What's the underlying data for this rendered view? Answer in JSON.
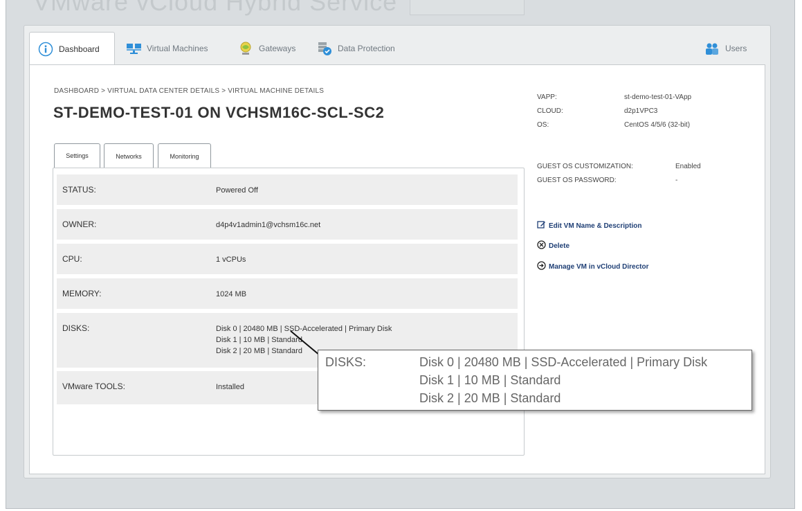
{
  "brand": {
    "title": "VMware vCloud Hybrid Service"
  },
  "main_tabs": [
    {
      "label": "Dashboard",
      "icon": "info-circle-icon"
    },
    {
      "label": "Virtual Machines",
      "icon": "monitors-icon"
    },
    {
      "label": "Gateways",
      "icon": "gateway-globe-icon"
    },
    {
      "label": "Data Protection",
      "icon": "data-protection-icon"
    }
  ],
  "users_tab": {
    "label": "Users",
    "icon": "users-icon"
  },
  "breadcrumb": "DASHBOARD > VIRTUAL DATA CENTER DETAILS > VIRTUAL MACHINE DETAILS",
  "page_title": "ST-DEMO-TEST-01 ON VCHSM16C-SCL-SC2",
  "inner_tabs": [
    "Settings",
    "Networks",
    "Monitoring"
  ],
  "settings": {
    "status_label": "STATUS:",
    "status_value": "Powered Off",
    "owner_label": "OWNER:",
    "owner_value": "d4p4v1admin1@vchsm16c.net",
    "cpu_label": "CPU:",
    "cpu_value": "1 vCPUs",
    "memory_label": "MEMORY:",
    "memory_value": "1024 MB",
    "disks_label": "DISKS:",
    "disks": [
      "Disk 0  |  20480 MB  |  SSD-Accelerated  |  Primary Disk",
      "Disk 1  |  10 MB  |  Standard",
      "Disk 2  |  20 MB  |  Standard"
    ],
    "tools_label": "VMware TOOLS:",
    "tools_value": "Installed"
  },
  "meta": {
    "vapp_label": "VAPP:",
    "vapp_value": "st-demo-test-01-VApp",
    "cloud_label": "CLOUD:",
    "cloud_value": "d2p1VPC3",
    "os_label": "OS:",
    "os_value": "CentOS 4/5/6 (32-bit)",
    "guest_custom_label": "GUEST OS CUSTOMIZATION:",
    "guest_custom_value": "Enabled",
    "guest_pass_label": "GUEST OS PASSWORD:",
    "guest_pass_value": "-"
  },
  "actions": {
    "edit": "Edit VM Name & Description",
    "delete": "Delete",
    "manage": "Manage VM in vCloud Director"
  },
  "callout": {
    "label": "DISKS:",
    "lines": [
      "Disk 0  |  20480 MB  |  SSD-Accelerated  |  Primary Disk",
      "Disk 1  |  10 MB  |  Standard",
      "Disk 2  |  20 MB  |  Standard"
    ]
  },
  "colors": {
    "link": "#1f3f75",
    "accent": "#2f8fd8",
    "row_bg": "#eeeeee"
  }
}
